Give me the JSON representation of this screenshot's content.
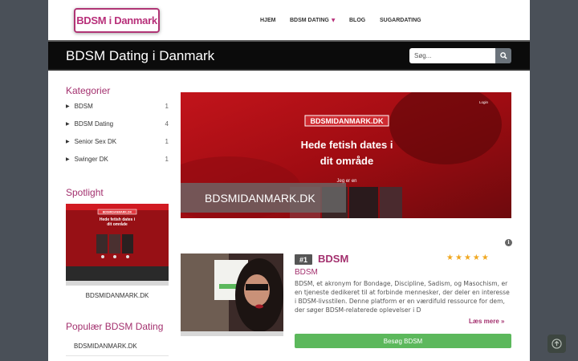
{
  "header": {
    "logo_text": "BDSM i Danmark",
    "nav": [
      {
        "label": "HJEM"
      },
      {
        "label": "BDSM DATING",
        "caret": "▼"
      },
      {
        "label": "BLOG"
      },
      {
        "label": "SUGARDATING"
      }
    ]
  },
  "titlebar": {
    "title": "BDSM Dating i Danmark",
    "search_placeholder": "Søg..."
  },
  "sidebar": {
    "categories_heading": "Kategorier",
    "categories": [
      {
        "label": "BDSM",
        "count": "1"
      },
      {
        "label": "BDSM Dating",
        "count": "4"
      },
      {
        "label": "Senior Sex DK",
        "count": "1"
      },
      {
        "label": "Swinger DK",
        "count": "1"
      }
    ],
    "spotlight_heading": "Spotlight",
    "spotlight_caption": "BDSMIDANMARK.DK",
    "spotlight_image": {
      "logo": "BDSMIDANMARK.DK",
      "headline": "Hede fetish dates i dit område"
    },
    "popular_heading": "Populær BDSM Dating",
    "popular_items": [
      "BDSMIDANMARK.DK"
    ]
  },
  "hero": {
    "logo": "BDSMIDANMARK.DK",
    "login": "Login",
    "headline_1": "Hede fetish dates i",
    "headline_2": "dit område",
    "prompt": "Jeg er en",
    "caption": "BDSMIDANMARK.DK"
  },
  "listing": {
    "rank": "#1",
    "name": "BDSM",
    "rating": 5,
    "subtitle": "BDSM",
    "description": "BDSM, et akronym for Bondage, Discipline, Sadism, og Masochism, er en tjeneste dedikeret til at forbinde mennesker, der deler en interesse i BDSM-livsstilen. Denne platform er en værdifuld ressource for dem, der søger BDSM-relaterede oplevelser i D",
    "more": "Læs mere »",
    "visit": "Besøg BDSM"
  },
  "colors": {
    "accent": "#a3306e",
    "green": "#5cb85c",
    "star": "#f0a821"
  }
}
